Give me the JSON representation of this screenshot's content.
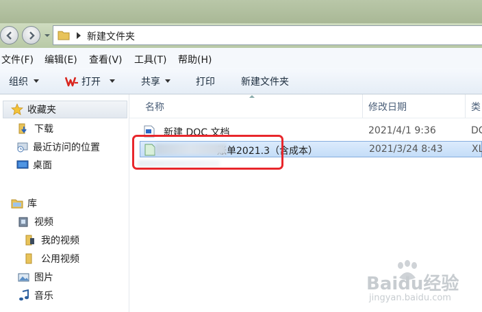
{
  "address": {
    "path": "新建文件夹"
  },
  "menu": [
    "文件(F)",
    "编辑(E)",
    "查看(V)",
    "工具(T)",
    "帮助(H)"
  ],
  "toolbar": {
    "organize": "组织",
    "open": "打开",
    "share": "共享",
    "print": "打印",
    "new_folder": "新建文件夹"
  },
  "sidebar": {
    "favorites": "收藏夹",
    "downloads": "下载",
    "recent": "最近访问的位置",
    "desktop": "桌面",
    "libraries": "库",
    "videos": "视频",
    "my_videos": "我的视频",
    "public_videos": "公用视频",
    "pictures": "图片",
    "music": "音乐"
  },
  "columns": {
    "name": "名称",
    "modified": "修改日期",
    "type": "类"
  },
  "files": [
    {
      "name": "新建 DOC 文档",
      "modified": "2021/4/1 9:36",
      "type": "DC",
      "icon": "doc-file-icon"
    },
    {
      "name": "账单2021.3（含成本）",
      "modified": "2021/3/24 8:43",
      "type": "XL",
      "icon": "xls-file-icon",
      "selected": true
    }
  ],
  "watermark": {
    "brand": "Baidu经验",
    "url": "jingyan.baidu.com"
  },
  "colors": {
    "highlight": "#e8262b",
    "selection": "#c4ddf8",
    "wps": "#d9251d"
  }
}
